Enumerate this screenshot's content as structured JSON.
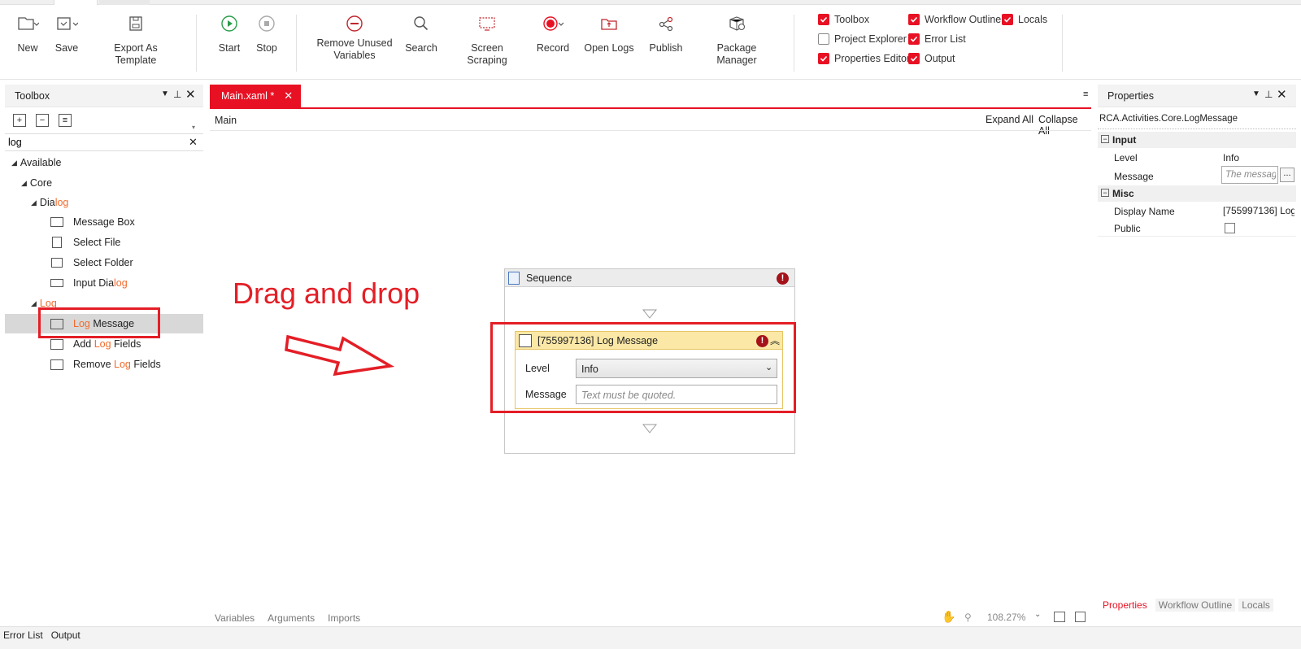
{
  "ribbon": {
    "new": "New",
    "save": "Save",
    "export_template": "Export As Template",
    "start": "Start",
    "stop": "Stop",
    "remove_unused_line1": "Remove Unused",
    "remove_unused_line2": "Variables",
    "search": "Search",
    "screen_scraping": "Screen Scraping",
    "record": "Record",
    "open_logs": "Open Logs",
    "publish": "Publish",
    "package_manager": "Package Manager",
    "panels": {
      "toolbox": "Toolbox",
      "workflow_outline": "Workflow Outline",
      "locals": "Locals",
      "project_explorer": "Project Explorer",
      "error_list": "Error List",
      "properties_editor": "Properties Editor",
      "output": "Output"
    }
  },
  "toolbox": {
    "title": "Toolbox",
    "search_value": "log",
    "tree": {
      "available": "Available",
      "core": "Core",
      "dialog_pre": "Dia",
      "dialog_hl": "log",
      "message_box": "Message Box",
      "select_file": "Select File",
      "select_folder": "Select Folder",
      "input_dialog_pre": "Input Dia",
      "input_dialog_hl": "log",
      "log_group": "Log",
      "log_message_hl": "Log",
      "log_message_rest": " Message",
      "add_log_pre": "Add ",
      "add_log_hl": "Log",
      "add_log_post": " Fields",
      "remove_log_pre": "Remove ",
      "remove_log_hl": "Log",
      "remove_log_post": " Fields"
    }
  },
  "designer": {
    "tab_label": "Main.xaml *",
    "breadcrumb": "Main",
    "expand_all": "Expand All",
    "collapse_all": "Collapse All",
    "annotation": "Drag and drop",
    "sequence_title": "Sequence",
    "activity_title": "[755997136] Log Message",
    "level_label": "Level",
    "level_value": "Info",
    "message_label": "Message",
    "message_placeholder": "Text must be quoted.",
    "bottom_tabs": [
      "Variables",
      "Arguments",
      "Imports"
    ],
    "zoom": "108.27%"
  },
  "properties": {
    "title": "Properties",
    "type_name": "RCA.Activities.Core.LogMessage",
    "cat_input": "Input",
    "level_label": "Level",
    "level_value": "Info",
    "message_label": "Message",
    "message_placeholder": "The messag",
    "ellipsis": "...",
    "cat_misc": "Misc",
    "display_name_label": "Display Name",
    "display_name_value": "[755997136] Log",
    "public_label": "Public",
    "bottom_tabs": [
      "Properties",
      "Workflow Outline",
      "Locals"
    ]
  },
  "statusbar": {
    "error_list": "Error List",
    "output": "Output"
  },
  "colors": {
    "accent": "#e81123",
    "highlight_text": "#f26a2c",
    "activity_header": "#fbe8a6",
    "annotation": "#e41e26"
  }
}
